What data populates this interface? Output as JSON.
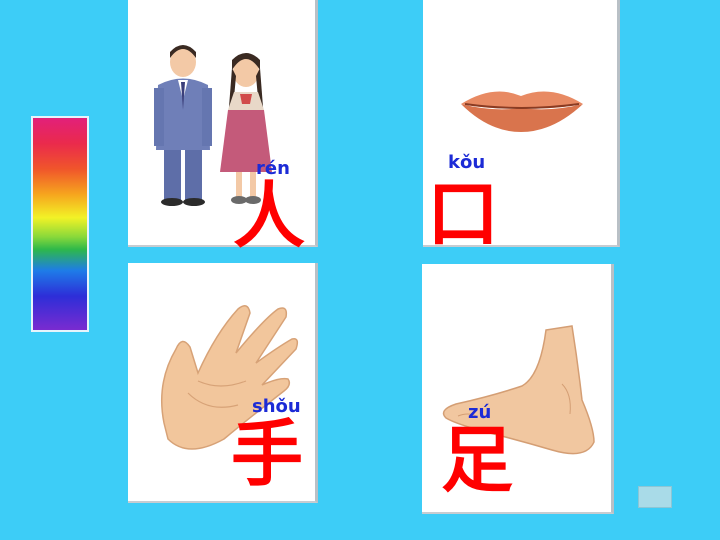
{
  "cards": [
    {
      "id": "people",
      "pinyin": "rén",
      "hanzi": "人"
    },
    {
      "id": "mouth",
      "pinyin": "kǒu",
      "hanzi": "口"
    },
    {
      "id": "hand",
      "pinyin": "shǒu",
      "hanzi": "手"
    },
    {
      "id": "foot",
      "pinyin": "zú",
      "hanzi": "足"
    }
  ],
  "colors": {
    "background": "#3dcdf7",
    "pinyin": "#1c2bd6",
    "hanzi": "#ff0000"
  },
  "icons": {
    "rainbow": "rainbow-gradient-bar",
    "nav": "next-slide-button"
  }
}
